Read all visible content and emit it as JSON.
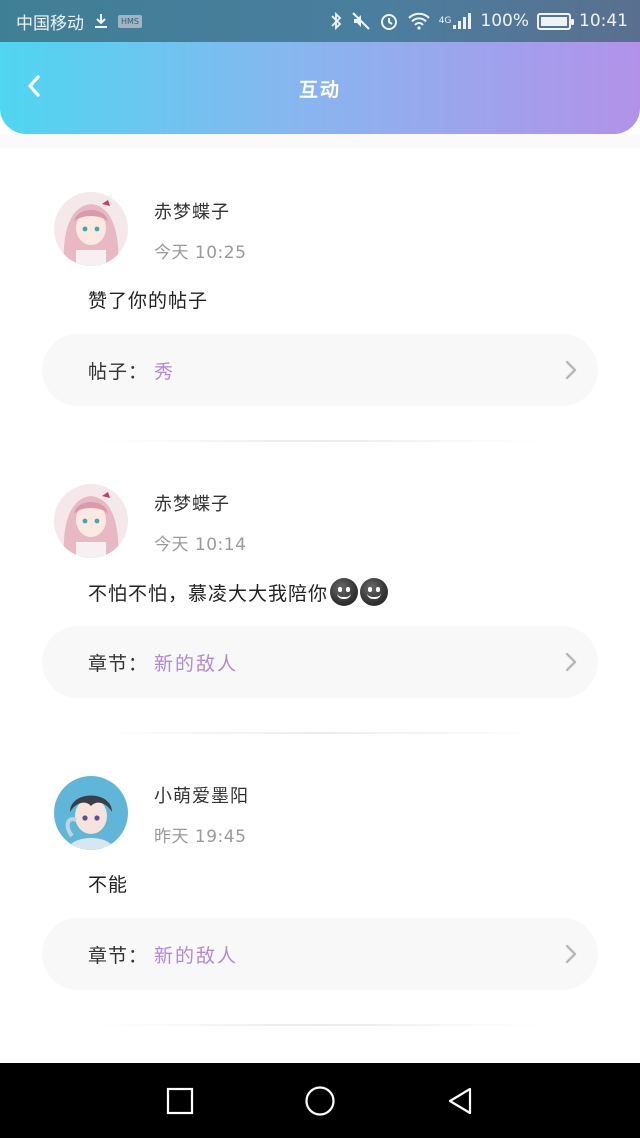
{
  "status_bar": {
    "carrier": "中国移动",
    "hms_badge": "HMS",
    "network": "4G",
    "battery": "100%",
    "time": "10:41"
  },
  "header": {
    "title": "互动",
    "back_icon": "chevron-left-icon"
  },
  "feed": [
    {
      "username": "赤梦蝶子",
      "time": "今天 10:25",
      "message": "赞了你的帖子",
      "emoji_count": 0,
      "link_label": "帖子：",
      "link_value": "秀",
      "avatar": "pink-hair-girl"
    },
    {
      "username": "赤梦蝶子",
      "time": "今天 10:14",
      "message": "不怕不怕，慕凌大大我陪你",
      "emoji_count": 2,
      "link_label": "章节：",
      "link_value": "新的敌人",
      "avatar": "pink-hair-girl"
    },
    {
      "username": "小萌爱墨阳",
      "time": "昨天 19:45",
      "message": "不能",
      "emoji_count": 0,
      "link_label": "章节：",
      "link_value": "新的敌人",
      "avatar": "dark-hair-boy"
    }
  ],
  "colors": {
    "header_gradient_start": "#4fd6f1",
    "header_gradient_end": "#b292e9",
    "link_value": "#b08ad8",
    "timestamp": "#9a9a9a"
  },
  "nav_bar": {
    "icons": [
      "recent-apps-icon",
      "home-icon",
      "back-icon"
    ]
  }
}
